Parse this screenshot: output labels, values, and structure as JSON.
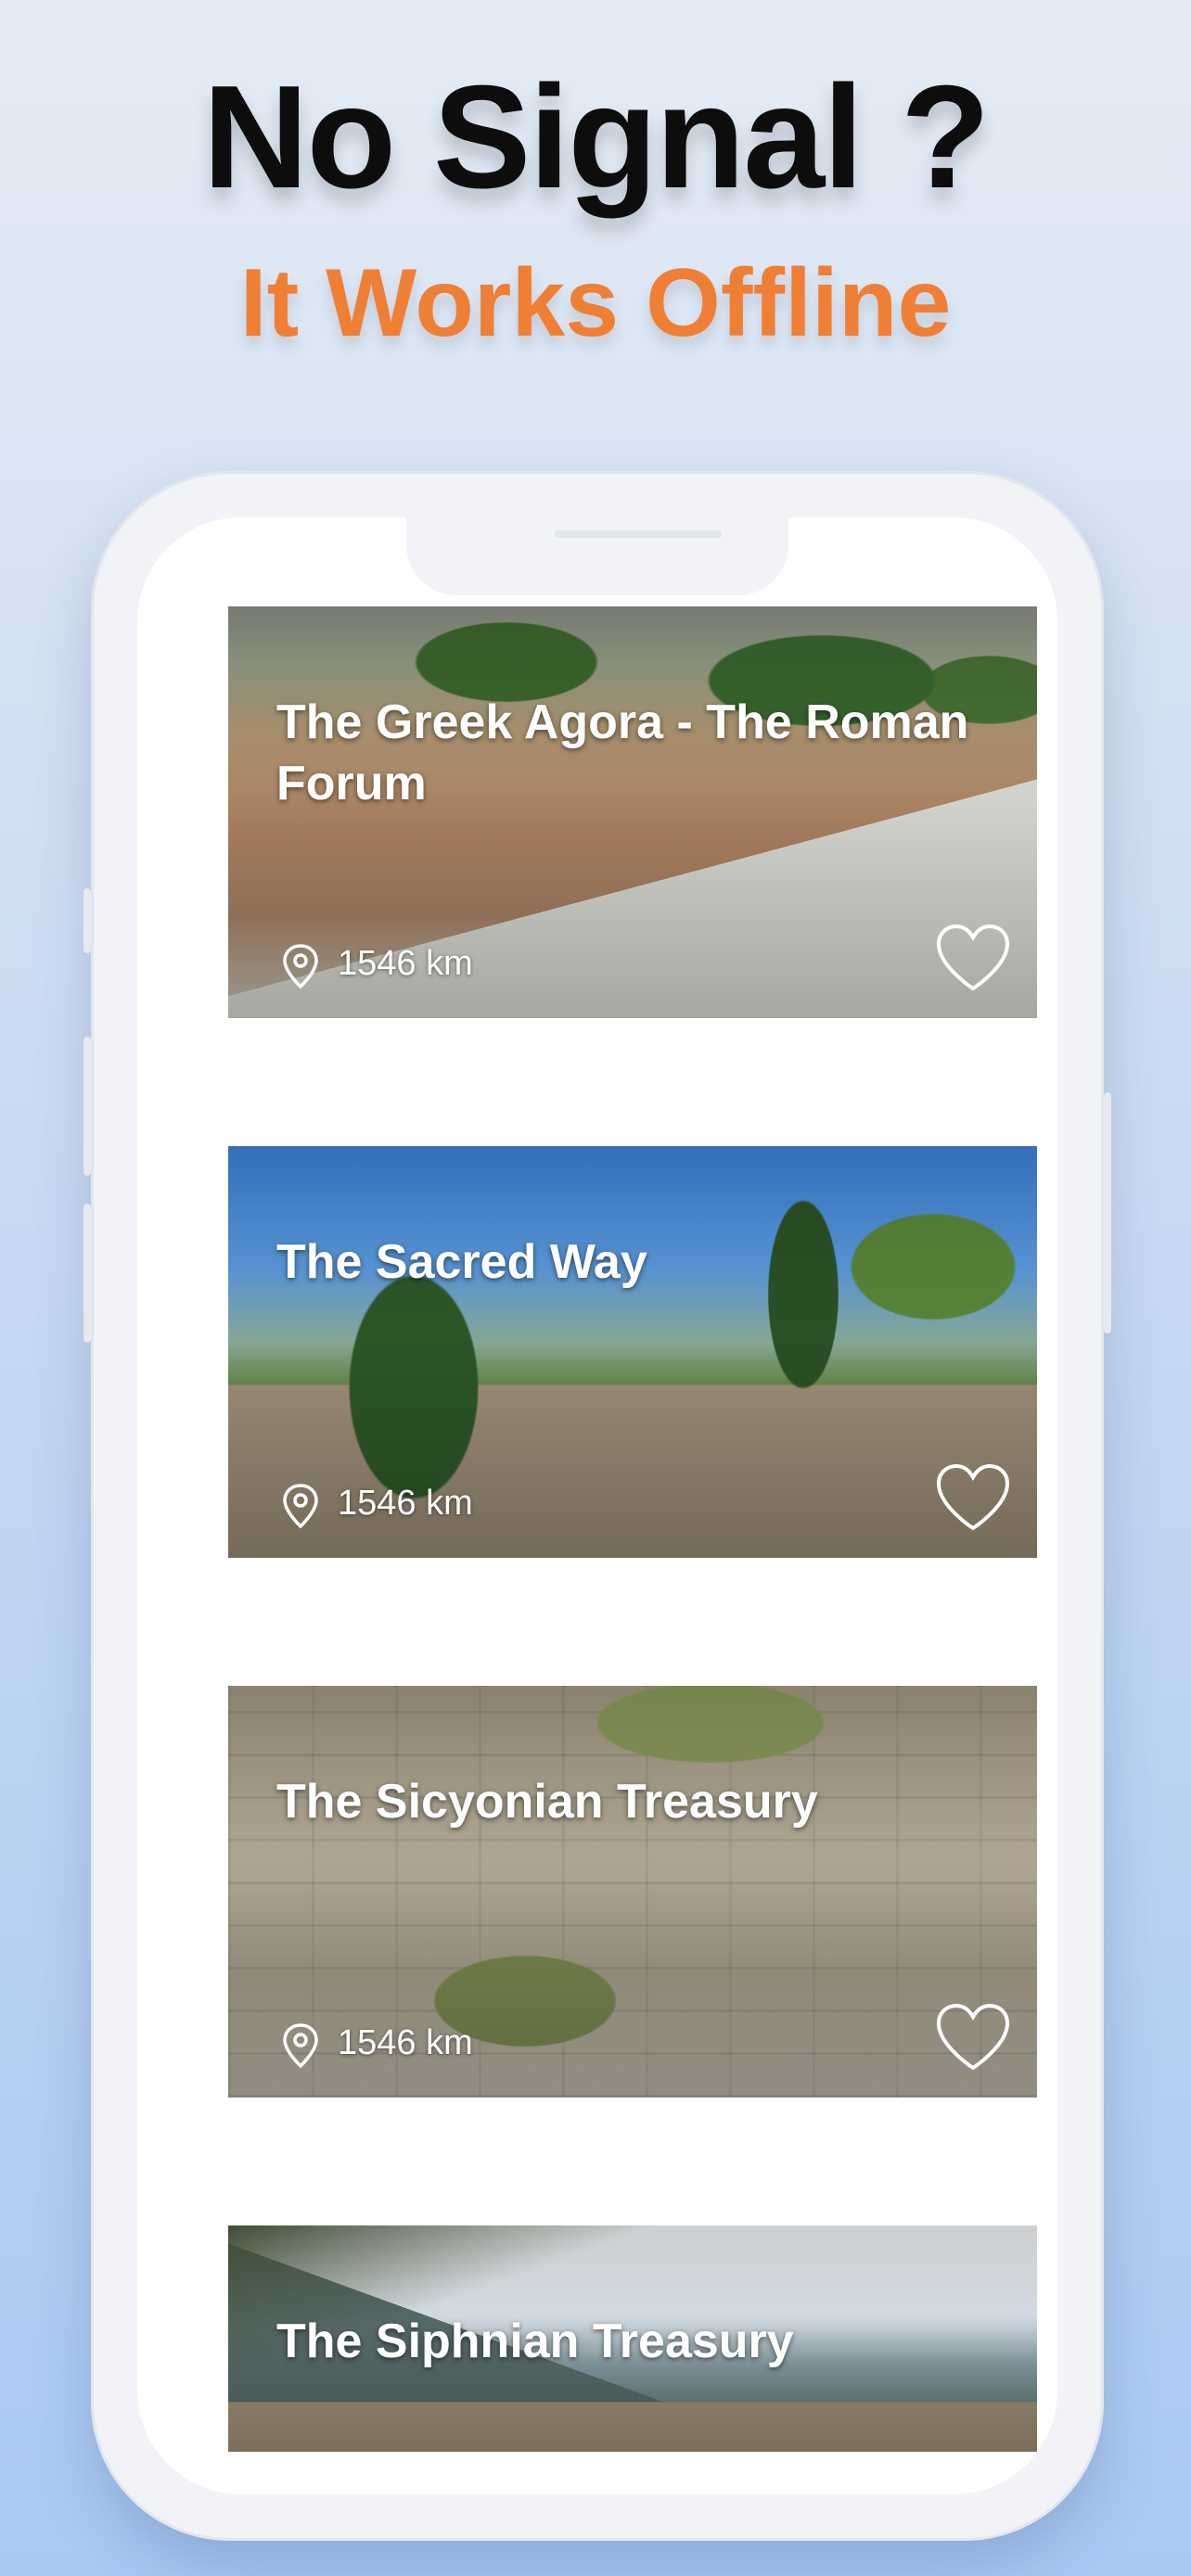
{
  "header": {
    "headline": "No Signal ?",
    "subheadline": "It Works Offline",
    "subheadline_color": "#ef7f35"
  },
  "places": [
    {
      "title": "The Greek Agora - The Roman Forum",
      "distance": "1546 km",
      "pin_icon": "location-pin-icon",
      "favorite_icon": "heart-outline-icon"
    },
    {
      "title": "The Sacred Way",
      "distance": "1546 km",
      "pin_icon": "location-pin-icon",
      "favorite_icon": "heart-outline-icon"
    },
    {
      "title": "The Sicyonian Treasury",
      "distance": "1546 km",
      "pin_icon": "location-pin-icon",
      "favorite_icon": "heart-outline-icon"
    },
    {
      "title": "The Siphnian Treasury"
    }
  ]
}
